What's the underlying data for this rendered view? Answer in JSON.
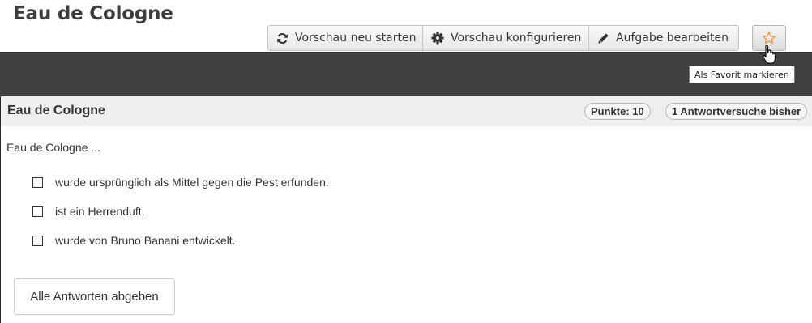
{
  "page": {
    "title": "Eau de Cologne"
  },
  "toolbar": {
    "restart_label": "Vorschau neu starten",
    "configure_label": "Vorschau konfigurieren",
    "edit_label": "Aufgabe bearbeiten",
    "favorite_tooltip": "Als Favorit markieren",
    "icons": [
      "refresh-icon",
      "gear-icon",
      "pencil-icon",
      "star-icon"
    ]
  },
  "question": {
    "title": "Eau de Cologne",
    "points_badge": "Punkte: 10",
    "attempts_badge": "1 Antwortversuche bisher",
    "text": "Eau de Cologne ...",
    "options": [
      {
        "label": "wurde ursprünglich als Mittel gegen die Pest erfunden.",
        "checked": false
      },
      {
        "label": "ist ein Herrenduft.",
        "checked": false
      },
      {
        "label": "wurde von Bruno Banani entwickelt.",
        "checked": false
      }
    ],
    "submit_label": "Alle Antworten abgeben"
  },
  "colors": {
    "dark_bar": "#404040",
    "header_bg": "#efefef",
    "star_accent": "#e8943a"
  }
}
